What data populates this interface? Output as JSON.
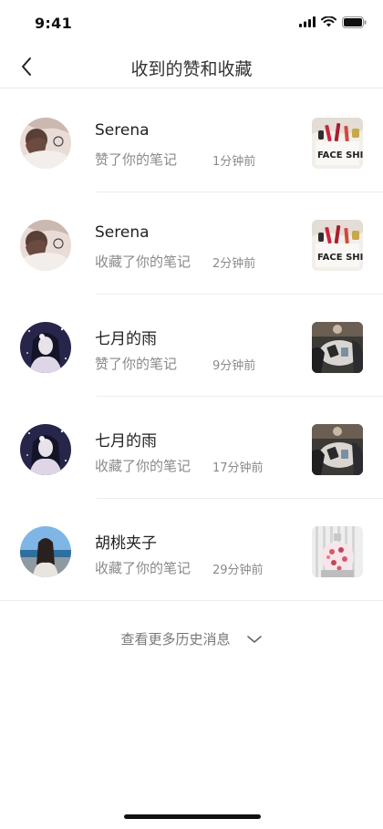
{
  "status_bar": {
    "time": "9:41"
  },
  "header": {
    "title": "收到的赞和收藏"
  },
  "notifications": [
    {
      "user": "Serena",
      "action": "赞了你的笔记",
      "time": "1分钟前",
      "avatar": "avatar-girl-white-sweater",
      "thumb": "note-face-shirt-lipsticks"
    },
    {
      "user": "Serena",
      "action": "收藏了你的笔记",
      "time": "2分钟前",
      "avatar": "avatar-girl-white-sweater",
      "thumb": "note-face-shirt-lipsticks"
    },
    {
      "user": "七月的雨",
      "action": "赞了你的笔记",
      "time": "9分钟前",
      "avatar": "avatar-girl-starry-night",
      "thumb": "note-cafe-table"
    },
    {
      "user": "七月的雨",
      "action": "收藏了你的笔记",
      "time": "17分钟前",
      "avatar": "avatar-girl-starry-night",
      "thumb": "note-cafe-table"
    },
    {
      "user": "胡桃夹子",
      "action": "收藏了你的笔记",
      "time": "29分钟前",
      "avatar": "avatar-girl-seaside",
      "thumb": "note-floral-perfume"
    }
  ],
  "footer": {
    "more_label": "查看更多历史消息"
  },
  "colors": {
    "text_primary": "#222222",
    "text_secondary": "#8a8a8a",
    "divider": "#ececec"
  }
}
